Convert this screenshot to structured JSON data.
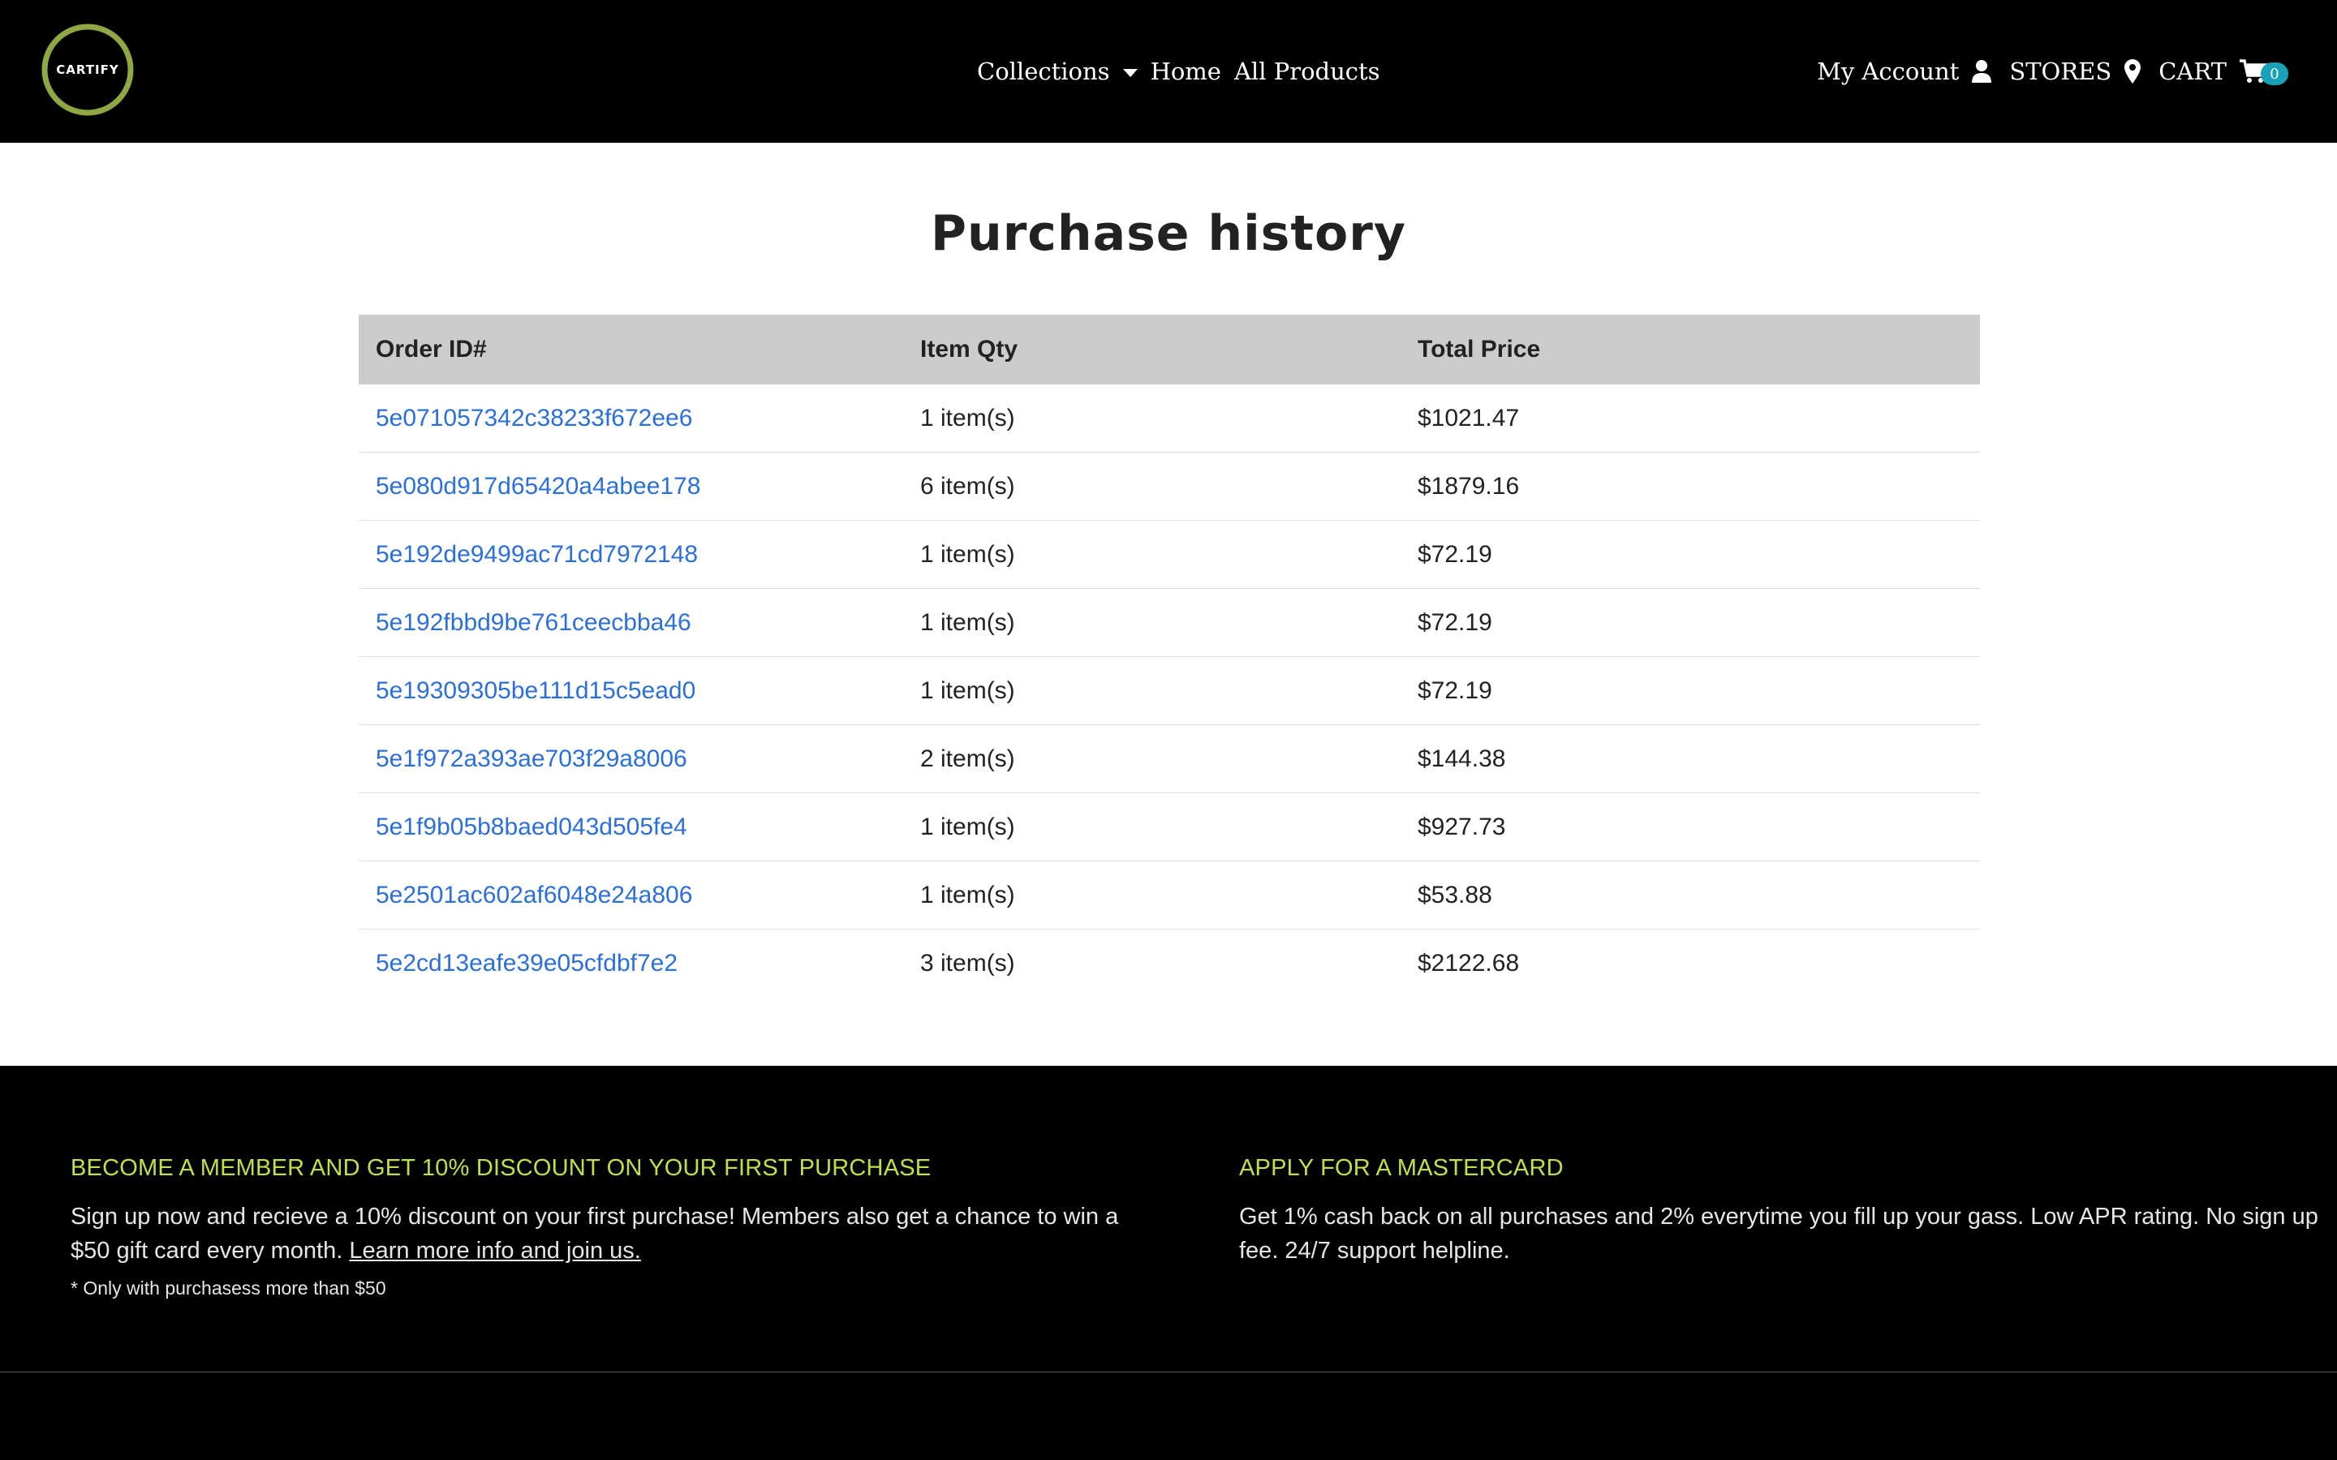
{
  "brand": {
    "logo_text": "CARTIFY",
    "ring_color": "#8fa844"
  },
  "nav": {
    "collections": "Collections",
    "home": "Home",
    "all_products": "All Products",
    "my_account": "My Account",
    "stores": "STORES",
    "cart": "CART",
    "cart_count": "0"
  },
  "page": {
    "title": "Purchase history"
  },
  "table": {
    "headers": {
      "order_id": "Order ID#",
      "item_qty": "Item Qty",
      "total_price": "Total Price"
    },
    "rows": [
      {
        "order_id": "5e071057342c38233f672ee6",
        "qty": "1 item(s)",
        "total": "$1021.47"
      },
      {
        "order_id": "5e080d917d65420a4abee178",
        "qty": "6 item(s)",
        "total": "$1879.16"
      },
      {
        "order_id": "5e192de9499ac71cd7972148",
        "qty": "1 item(s)",
        "total": "$72.19"
      },
      {
        "order_id": "5e192fbbd9be761ceecbba46",
        "qty": "1 item(s)",
        "total": "$72.19"
      },
      {
        "order_id": "5e19309305be111d15c5ead0",
        "qty": "1 item(s)",
        "total": "$72.19"
      },
      {
        "order_id": "5e1f972a393ae703f29a8006",
        "qty": "2 item(s)",
        "total": "$144.38"
      },
      {
        "order_id": "5e1f9b05b8baed043d505fe4",
        "qty": "1 item(s)",
        "total": "$927.73"
      },
      {
        "order_id": "5e2501ac602af6048e24a806",
        "qty": "1 item(s)",
        "total": "$53.88"
      },
      {
        "order_id": "5e2cd13eafe39e05cfdbf7e2",
        "qty": "3 item(s)",
        "total": "$2122.68"
      }
    ]
  },
  "footer": {
    "member": {
      "heading": "BECOME A MEMBER AND GET 10% DISCOUNT ON YOUR FIRST PURCHASE",
      "text": "Sign up now and recieve a 10% discount on your first purchase! Members also get a chance to win a $50 gift card every month. ",
      "link": "Learn more info and join us.",
      "note": "* Only with purchasess more than $50"
    },
    "card": {
      "heading": "APPLY FOR A MASTERCARD",
      "text": "Get 1% cash back on all purchases and 2% everytime you fill up your gass. Low APR rating. No sign up fee. 24/7 support helpline."
    }
  },
  "colors": {
    "link": "#2a6fdb",
    "footer_heading": "#bfe04a",
    "table_header_bg": "#cccccc",
    "badge": "#17a2b8"
  },
  "icons": [
    "user-icon",
    "map-marker-icon",
    "cart-icon",
    "chevron-down-icon"
  ]
}
